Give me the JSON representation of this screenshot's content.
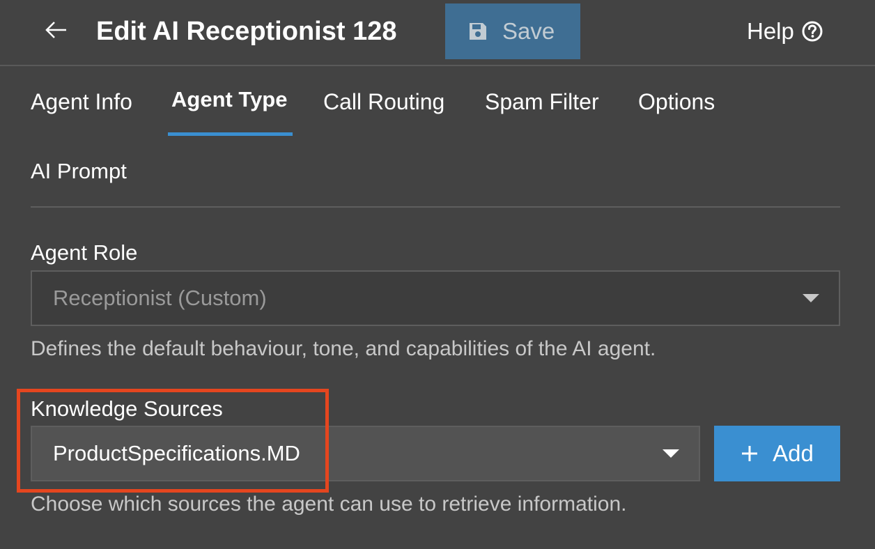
{
  "header": {
    "title": "Edit AI Receptionist 128",
    "save_label": "Save",
    "help_label": "Help",
    "back_icon": "arrow-left-icon",
    "save_icon": "floppy-disk-icon",
    "help_icon": "question-circle-icon"
  },
  "tabs": [
    {
      "label": "Agent Info",
      "active": false
    },
    {
      "label": "Agent Type",
      "active": true
    },
    {
      "label": "Call Routing",
      "active": false
    },
    {
      "label": "Spam Filter",
      "active": false
    },
    {
      "label": "Options",
      "active": false
    }
  ],
  "section": {
    "title": "AI Prompt"
  },
  "agent_role": {
    "label": "Agent Role",
    "selected": "Receptionist (Custom)",
    "helper": "Defines the default behaviour, tone, and capabilities of the AI agent."
  },
  "knowledge_sources": {
    "label": "Knowledge Sources",
    "selected": "ProductSpecifications.MD",
    "add_label": "Add",
    "add_icon": "plus-icon",
    "helper": "Choose which sources the agent can use to retrieve information."
  },
  "colors": {
    "background": "#434343",
    "accent": "#3a8fd1",
    "save_button": "#3f6e93",
    "highlight": "#e5461f"
  }
}
